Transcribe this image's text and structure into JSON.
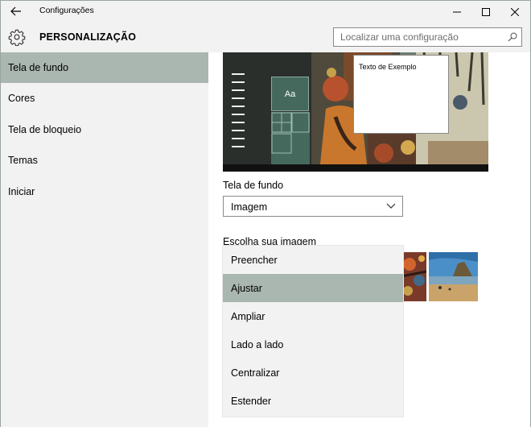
{
  "window": {
    "title": "Configurações"
  },
  "header": {
    "title": "PERSONALIZAÇÃO",
    "search_placeholder": "Localizar uma configuração"
  },
  "sidebar": {
    "items": [
      {
        "label": "Tela de fundo",
        "active": true
      },
      {
        "label": "Cores",
        "active": false
      },
      {
        "label": "Tela de bloqueio",
        "active": false
      },
      {
        "label": "Temas",
        "active": false
      },
      {
        "label": "Iniciar",
        "active": false
      }
    ]
  },
  "preview": {
    "sample_text": "Texto de Exemplo",
    "tile_label": "Aa"
  },
  "background": {
    "label": "Tela de fundo",
    "selected": "Imagem"
  },
  "choose_image": {
    "label": "Escolha sua imagem"
  },
  "fit_menu": {
    "options": [
      "Preencher",
      "Ajustar",
      "Ampliar",
      "Lado a lado",
      "Centralizar",
      "Estender"
    ],
    "selected": "Ajustar"
  },
  "colors": {
    "accent": "#aab6b0",
    "chrome": "#f2f2f2",
    "tile": "#46695e"
  }
}
